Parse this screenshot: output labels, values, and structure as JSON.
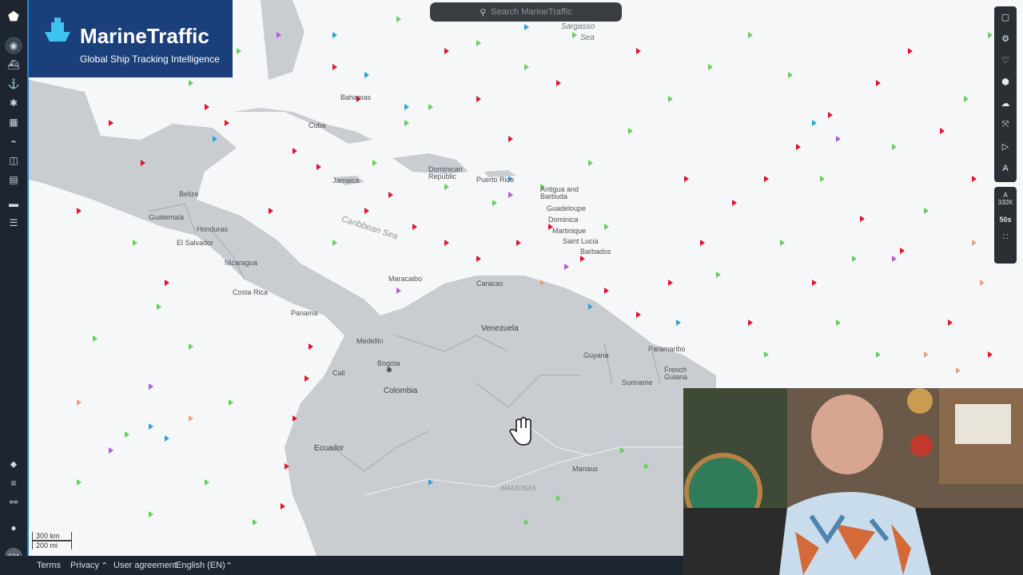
{
  "brand": {
    "name": "MarineTraffic",
    "tagline": "Global Ship Tracking Intelligence"
  },
  "search": {
    "placeholder": "Search MarineTraffic"
  },
  "map": {
    "labels": [
      "Sargasso\nSea",
      "Bahamas",
      "Cuba",
      "Jamaica",
      "Dominican\nRepublic",
      "Puerto Rico",
      "Antigua and\nBarbuda",
      "Guadeloupe",
      "Dominica",
      "Martinique",
      "Saint Lucia",
      "Barbados",
      "Caribbean Sea",
      "Belize",
      "Guatemala",
      "Honduras",
      "El Salvador",
      "Nicaragua",
      "Costa Rica",
      "Panama",
      "Venezuela",
      "Guyana",
      "Suriname",
      "French\nGuiana",
      "Colombia",
      "Bogota",
      "Ecuador",
      "Caracas",
      "Maracaibo",
      "Medellin",
      "Cali",
      "AMAZONAS",
      "Manaus",
      "Paramaribo"
    ]
  },
  "scale": {
    "km": "300 km",
    "mi": "200 mi"
  },
  "footer": {
    "terms": "Terms",
    "privacy": "Privacy",
    "agreement": "User agreement",
    "language": "English (EN)"
  },
  "right_panel": {
    "stats_value": "332K",
    "timer": "50s"
  },
  "user": {
    "initials": "SM"
  }
}
